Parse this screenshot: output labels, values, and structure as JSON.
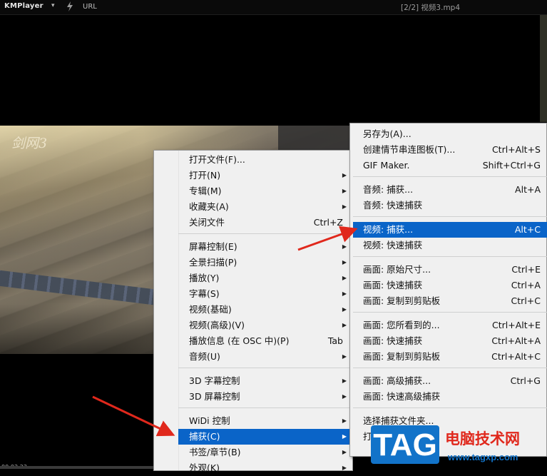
{
  "titlebar": {
    "logo": "KMPlayer",
    "url_label": "URL",
    "file_title": "[2/2] 视频3.mp4"
  },
  "video": {
    "watermark": "剑网3",
    "time": "00:03:23"
  },
  "main_menu": {
    "items": [
      {
        "label": "打开文件(F)...",
        "shortcut": "",
        "submenu": false
      },
      {
        "label": "打开(N)",
        "shortcut": "",
        "submenu": true
      },
      {
        "label": "专辑(M)",
        "shortcut": "",
        "submenu": true
      },
      {
        "label": "收藏夹(A)",
        "shortcut": "",
        "submenu": true
      },
      {
        "label": "关闭文件",
        "shortcut": "Ctrl+Z",
        "submenu": false
      },
      {
        "label": "屏幕控制(E)",
        "shortcut": "",
        "submenu": true
      },
      {
        "label": "全景扫描(P)",
        "shortcut": "",
        "submenu": true
      },
      {
        "label": "播放(Y)",
        "shortcut": "",
        "submenu": true
      },
      {
        "label": "字幕(S)",
        "shortcut": "",
        "submenu": true
      },
      {
        "label": "视频(基础)",
        "shortcut": "",
        "submenu": true
      },
      {
        "label": "视频(高级)(V)",
        "shortcut": "",
        "submenu": true
      },
      {
        "label": "播放信息 (在 OSC 中)(P)",
        "shortcut": "Tab",
        "submenu": false
      },
      {
        "label": "音频(U)",
        "shortcut": "",
        "submenu": true
      },
      {
        "label": "3D 字幕控制",
        "shortcut": "",
        "submenu": true
      },
      {
        "label": "3D 屏幕控制",
        "shortcut": "",
        "submenu": true
      },
      {
        "label": "WiDi 控制",
        "shortcut": "",
        "submenu": true
      },
      {
        "label": "捕获(C)",
        "shortcut": "",
        "submenu": true
      },
      {
        "label": "书签/章节(B)",
        "shortcut": "",
        "submenu": true
      },
      {
        "label": "外观(K)",
        "shortcut": "",
        "submenu": true
      }
    ]
  },
  "capture_menu": {
    "items": [
      {
        "label": "另存为(A)...",
        "shortcut": ""
      },
      {
        "label": "创建情节串连图板(T)...",
        "shortcut": "Ctrl+Alt+S"
      },
      {
        "label": "GIF Maker.",
        "shortcut": "Shift+Ctrl+G"
      },
      {
        "label": "音频: 捕获...",
        "shortcut": "Alt+A"
      },
      {
        "label": "音频: 快速捕获",
        "shortcut": ""
      },
      {
        "label": "视频: 捕获...",
        "shortcut": "Alt+C"
      },
      {
        "label": "视频: 快速捕获",
        "shortcut": ""
      },
      {
        "label": "画面: 原始尺寸...",
        "shortcut": "Ctrl+E"
      },
      {
        "label": "画面: 快速捕获",
        "shortcut": "Ctrl+A"
      },
      {
        "label": "画面: 复制到剪贴板",
        "shortcut": "Ctrl+C"
      },
      {
        "label": "画面: 您所看到的...",
        "shortcut": "Ctrl+Alt+E"
      },
      {
        "label": "画面: 快速捕获",
        "shortcut": "Ctrl+Alt+A"
      },
      {
        "label": "画面: 复制到剪贴板",
        "shortcut": "Ctrl+Alt+C"
      },
      {
        "label": "画面: 高级捕获...",
        "shortcut": "Ctrl+G"
      },
      {
        "label": "画面: 快速高级捕获",
        "shortcut": ""
      },
      {
        "label": "选择捕获文件夹...",
        "shortcut": ""
      },
      {
        "label": "打",
        "shortcut": ""
      }
    ]
  },
  "site_watermark": {
    "tag": "TAG",
    "name": "电脑技术网",
    "url": "www.tagxp.com"
  },
  "colors": {
    "highlight": "#0a64c8",
    "arrow": "#e0281c"
  }
}
